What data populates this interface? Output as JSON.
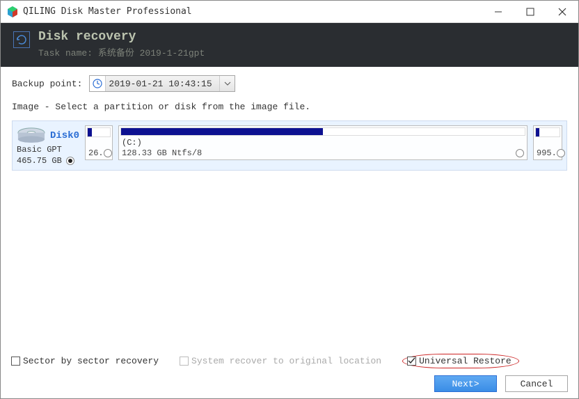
{
  "window": {
    "title": "QILING Disk Master Professional"
  },
  "header": {
    "title": "Disk recovery",
    "task_label": "Task name:",
    "task_name": "系统备份 2019-1-21gpt"
  },
  "backup": {
    "label": "Backup point:",
    "value": "2019-01-21 10:43:15"
  },
  "image_hint": "Image - Select a partition or disk from the image file.",
  "disk": {
    "name": "Disk0",
    "type": "Basic GPT",
    "size": "465.75 GB",
    "partitions": [
      {
        "label": "",
        "size": "26.",
        "fill_pct": 18,
        "selected": false
      },
      {
        "label": "(C:)",
        "size": "128.33 GB Ntfs/8",
        "fill_pct": 50,
        "selected": false
      },
      {
        "label": "",
        "size": "995.",
        "fill_pct": 15,
        "selected": false
      }
    ],
    "selected": true
  },
  "options": {
    "sector": {
      "label": "Sector by sector recovery",
      "checked": false,
      "enabled": true
    },
    "system_recover": {
      "label": "System recover to original location",
      "checked": false,
      "enabled": false
    },
    "universal": {
      "label": "Universal Restore",
      "checked": true,
      "enabled": true
    }
  },
  "buttons": {
    "next": "Next>",
    "cancel": "Cancel"
  }
}
